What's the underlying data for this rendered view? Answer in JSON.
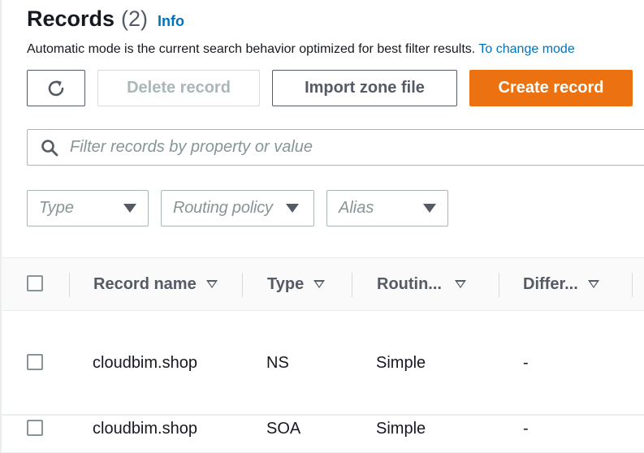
{
  "header": {
    "title": "Records",
    "count": "(2)",
    "info_link": "Info"
  },
  "description": {
    "text": "Automatic mode is the current search behavior optimized for best filter results. ",
    "link": "To change mode"
  },
  "toolbar": {
    "delete_label": "Delete record",
    "import_label": "Import zone file",
    "create_label": "Create record",
    "create_color": "#ec7211"
  },
  "search": {
    "placeholder": "Filter records by property or value"
  },
  "filters": {
    "type_placeholder": "Type",
    "routing_placeholder": "Routing policy",
    "alias_placeholder": "Alias"
  },
  "table": {
    "columns": [
      "Record name",
      "Type",
      "Routin...",
      "Differ..."
    ],
    "rows": [
      [
        "cloudbim.shop",
        "NS",
        "Simple",
        "-"
      ],
      [
        "cloudbim.shop",
        "SOA",
        "Simple",
        "-"
      ]
    ]
  }
}
